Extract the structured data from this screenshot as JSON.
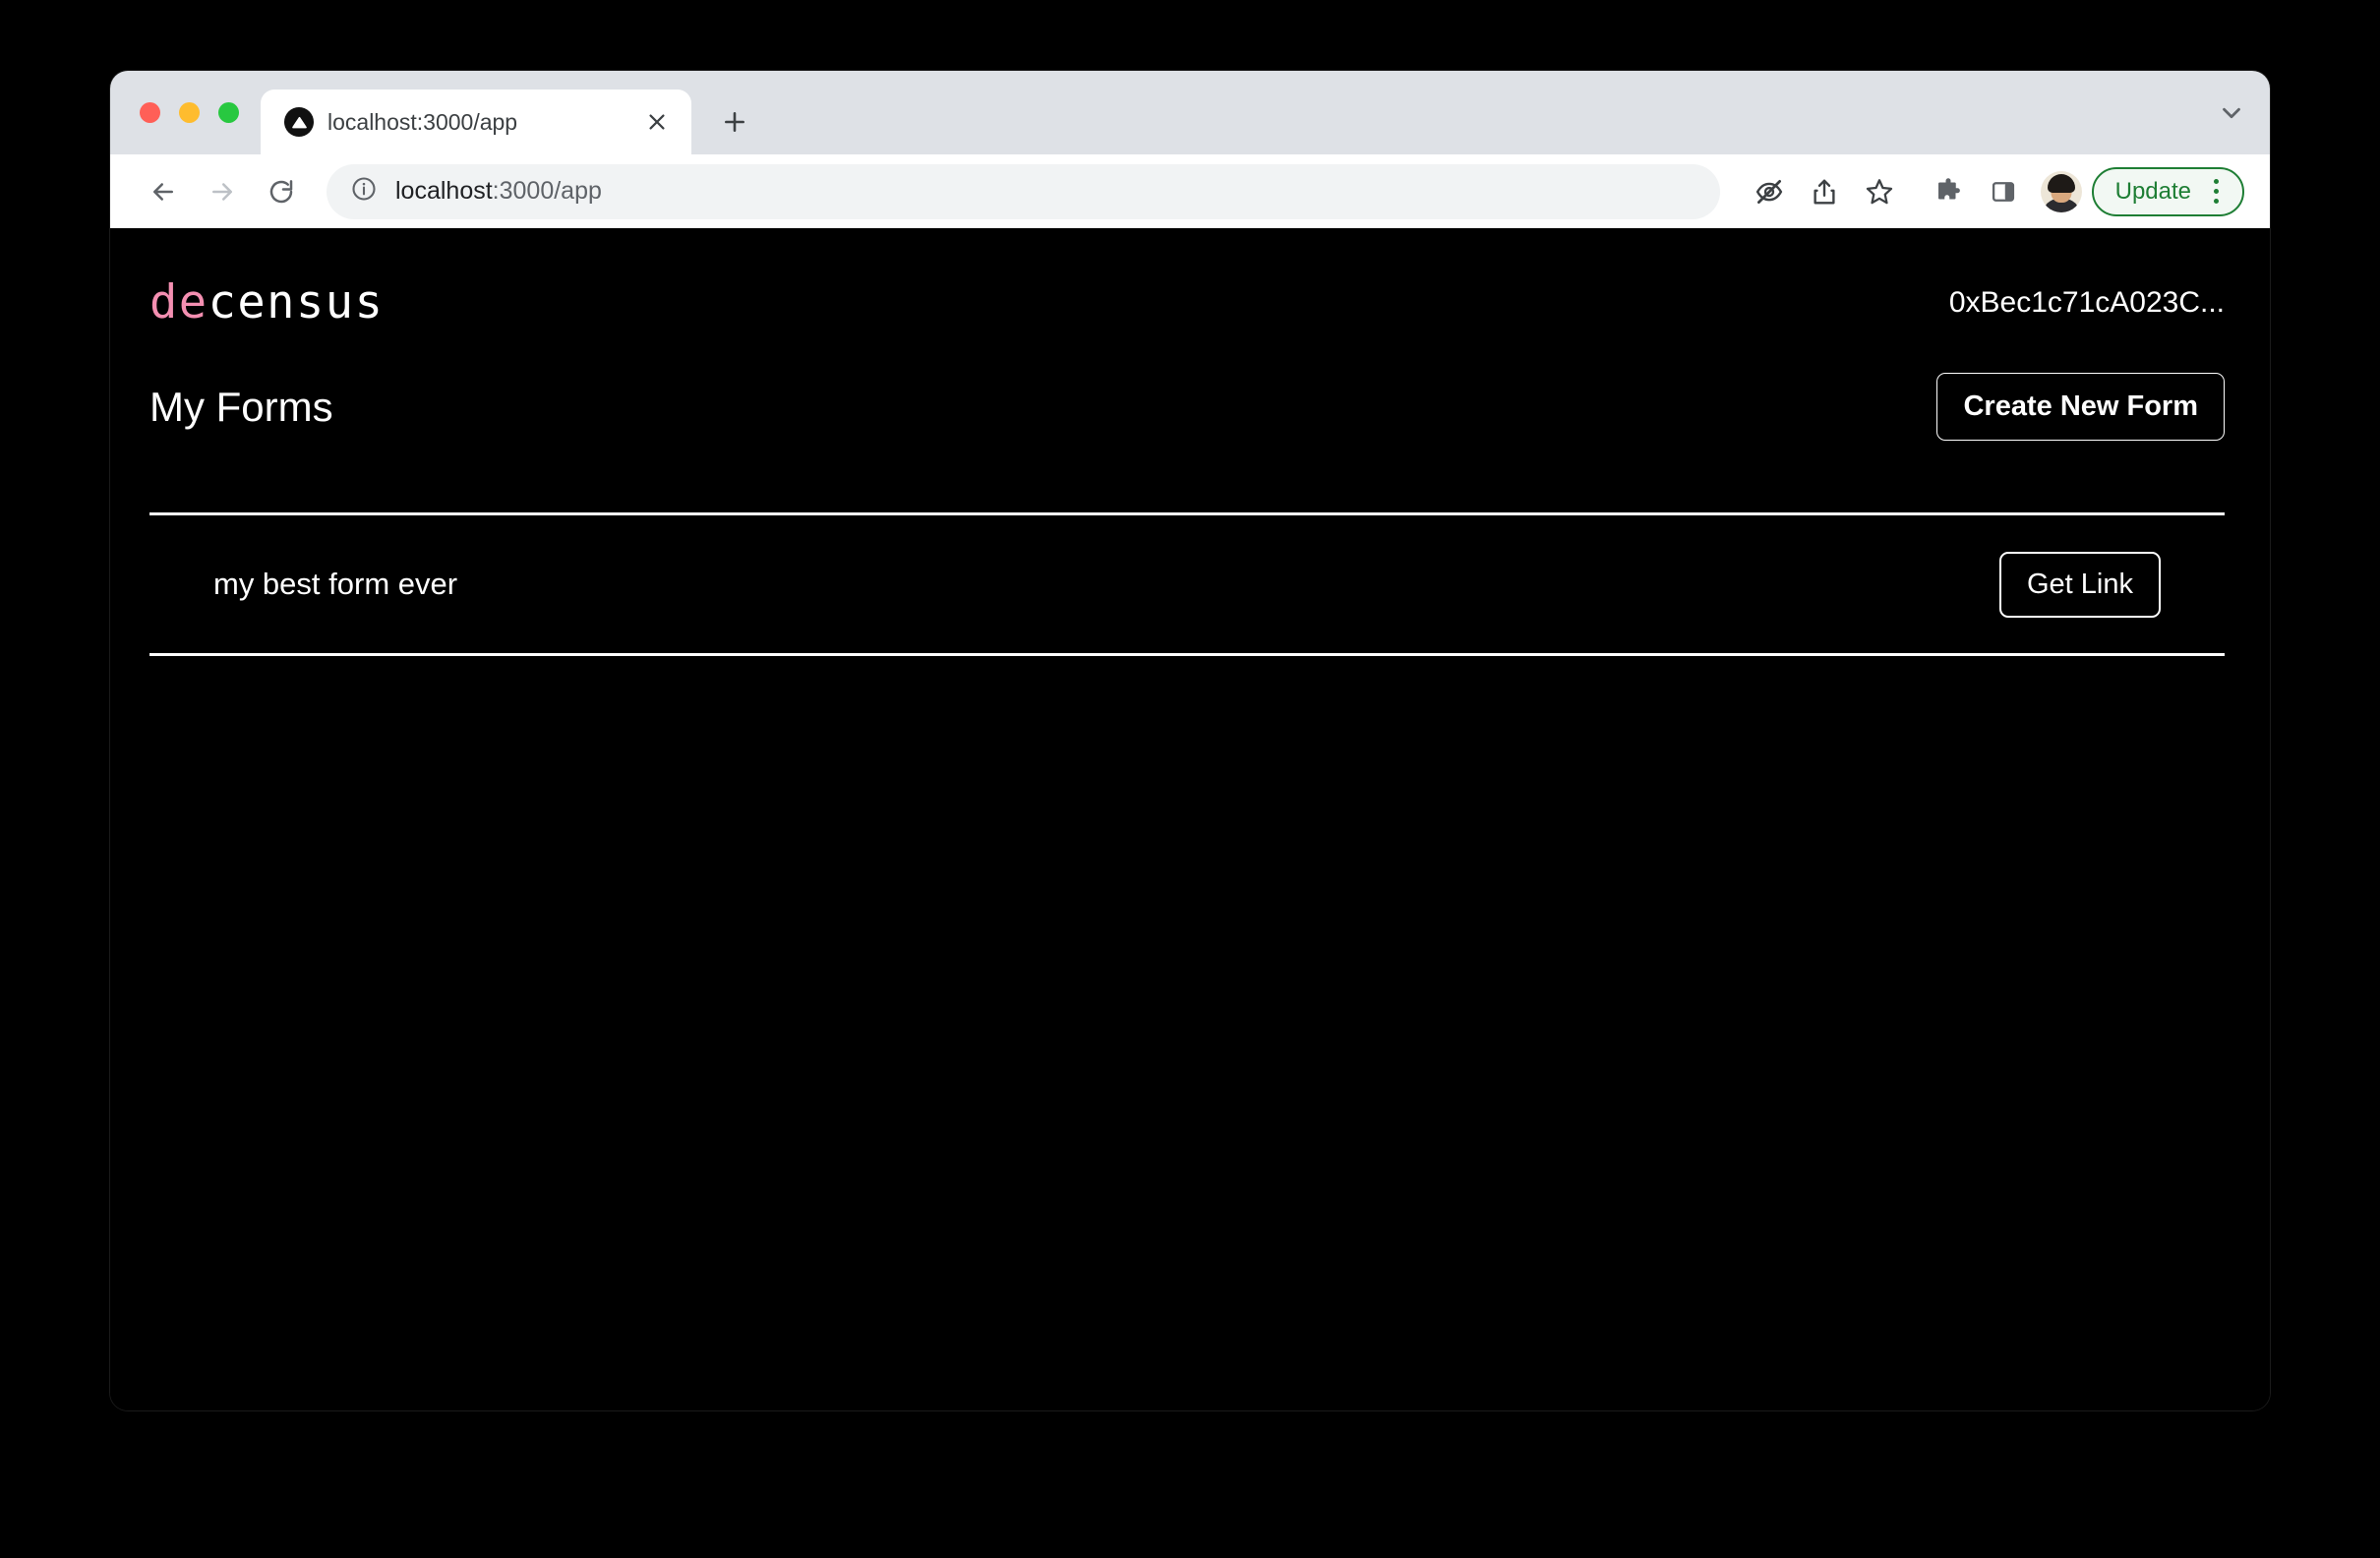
{
  "browser": {
    "traffic_lights": {
      "close_color": "#FF5F57",
      "minimize_color": "#FEBC2E",
      "maximize_color": "#28C840"
    },
    "tab": {
      "title": "localhost:3000/app",
      "favicon_name": "vercel-triangle-icon",
      "close_label": "×"
    },
    "new_tab_label": "+",
    "tabstrip_chevron_name": "chevron-down-icon",
    "nav": {
      "back_label": "←",
      "forward_label": "→",
      "reload_label": "↻"
    },
    "omnibox": {
      "info_icon": "info-circle-icon",
      "host": "localhost",
      "path": ":3000/app",
      "full_url": "localhost:3000/app"
    },
    "toolbar_icons": [
      "eye-off-icon",
      "share-icon",
      "bookmark-star-icon",
      "extensions-puzzle-icon",
      "side-panel-icon"
    ],
    "avatar_name": "profile-avatar",
    "update": {
      "label": "Update",
      "border_color": "#1E7E34",
      "text_color": "#1E7E34",
      "background": "#F2F8F3"
    }
  },
  "app": {
    "logo": {
      "prefix": "de",
      "suffix": "census",
      "prefix_color": "#F48FB1",
      "suffix_color": "#FFFFFF"
    },
    "wallet_address": "0xBec1c71cA023C...",
    "page_title": "My Forms",
    "create_form_label": "Create New Form",
    "forms": [
      {
        "name": "my best form ever",
        "action_label": "Get Link"
      }
    ],
    "background": "#000000",
    "foreground": "#FFFFFF"
  }
}
